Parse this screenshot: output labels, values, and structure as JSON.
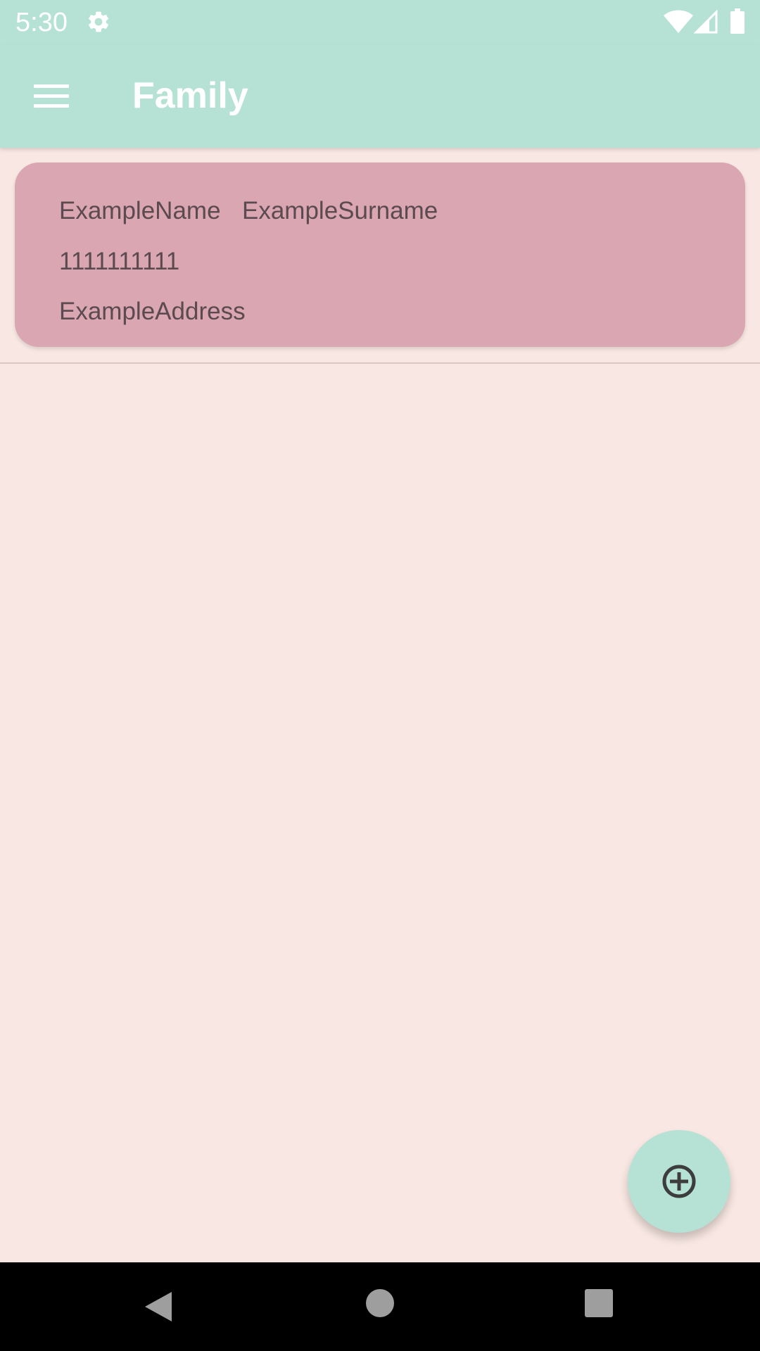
{
  "status_bar": {
    "time": "5:30",
    "icons": [
      "gear-icon",
      "wifi-icon",
      "signal-icon",
      "battery-icon"
    ]
  },
  "app_bar": {
    "title": "Family",
    "menu_icon": "hamburger-menu-icon",
    "background_color": "#b5e2d4"
  },
  "contacts": [
    {
      "name": "ExampleName",
      "surname": "ExampleSurname",
      "phone": "1111111111",
      "address": "ExampleAddress"
    }
  ],
  "fab": {
    "icon": "add-circle-icon",
    "color": "#b5e2d4"
  },
  "nav_bar": {
    "icons": [
      "back-icon",
      "home-icon",
      "recents-icon"
    ]
  },
  "colors": {
    "background": "#f8e7e2",
    "card": "#d9a6b1",
    "accent": "#b5e2d4",
    "card_text": "#5b4a50"
  }
}
